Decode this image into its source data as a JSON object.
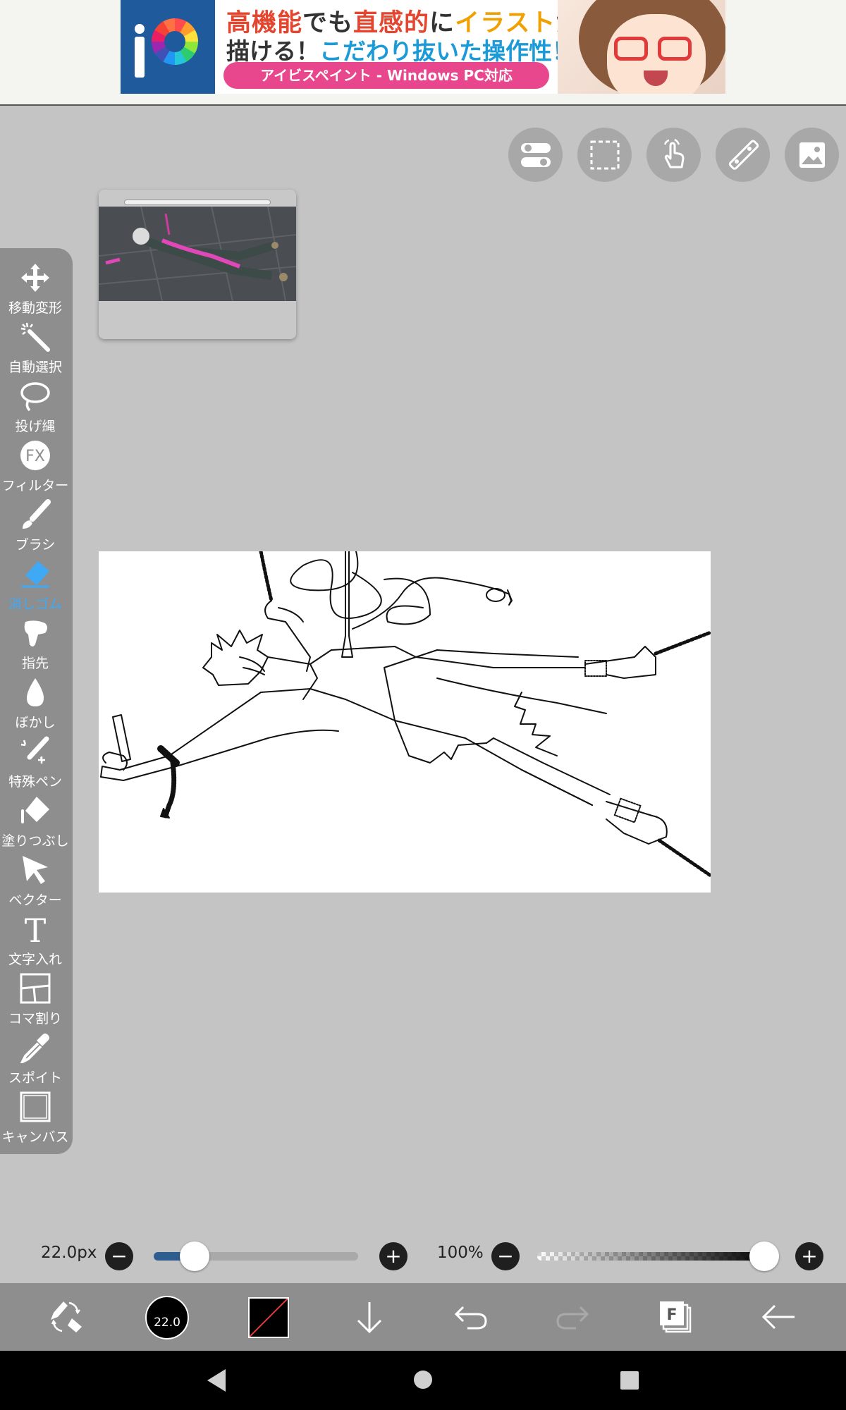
{
  "ad": {
    "line1_a": "高機能",
    "line1_b": "でも",
    "line1_c": "直感的",
    "line1_d": "に",
    "line1_e": "イラスト",
    "line1_f": "が",
    "line2_a": "描ける！",
    "line2_b": "こだわり抜いた操作性！",
    "pill": "アイビスペイント - Windows PC対応"
  },
  "top_buttons": [
    {
      "icon": "toggle-settings-icon"
    },
    {
      "icon": "selection-icon"
    },
    {
      "icon": "touch-gesture-icon"
    },
    {
      "icon": "ruler-icon"
    },
    {
      "icon": "reference-image-icon"
    }
  ],
  "tools": [
    {
      "label": "移動変形",
      "icon": "move-transform-icon"
    },
    {
      "label": "自動選択",
      "icon": "magic-wand-icon"
    },
    {
      "label": "投げ縄",
      "icon": "lasso-icon"
    },
    {
      "label": "フィルター",
      "icon": "filter-fx-icon",
      "badge": "FX"
    },
    {
      "label": "ブラシ",
      "icon": "brush-icon"
    },
    {
      "label": "消しゴム",
      "icon": "eraser-icon",
      "active": true
    },
    {
      "label": "指先",
      "icon": "finger-icon"
    },
    {
      "label": "ぼかし",
      "icon": "blur-drop-icon"
    },
    {
      "label": "特殊ペン",
      "icon": "special-pen-icon"
    },
    {
      "label": "塗りつぶし",
      "icon": "fill-bucket-icon"
    },
    {
      "label": "ベクター",
      "icon": "vector-cursor-icon"
    },
    {
      "label": "文字入れ",
      "icon": "text-icon",
      "badge": "T"
    },
    {
      "label": "コマ割り",
      "icon": "panel-divide-icon"
    },
    {
      "label": "スポイト",
      "icon": "eyedropper-icon"
    },
    {
      "label": "キャンバス",
      "icon": "canvas-icon"
    }
  ],
  "brush": {
    "size_label": "22.0px",
    "size_fraction": 0.2,
    "opacity_label": "100%",
    "opacity_fraction": 1.0,
    "size_badge": "22.0"
  },
  "bottom_bar": {
    "buttons": [
      "tool-swap-icon",
      "brush-size-icon",
      "color-icon",
      "layer-down-icon",
      "undo-icon",
      "redo-icon",
      "layers-icon",
      "back-arrow-icon"
    ],
    "layer_badge": "F"
  },
  "colors": {
    "accent": "#3fa9f5",
    "toolbar": "#8e8e8e",
    "workspace": "#c4c4c4",
    "slider_fill": "#2e5d90"
  }
}
